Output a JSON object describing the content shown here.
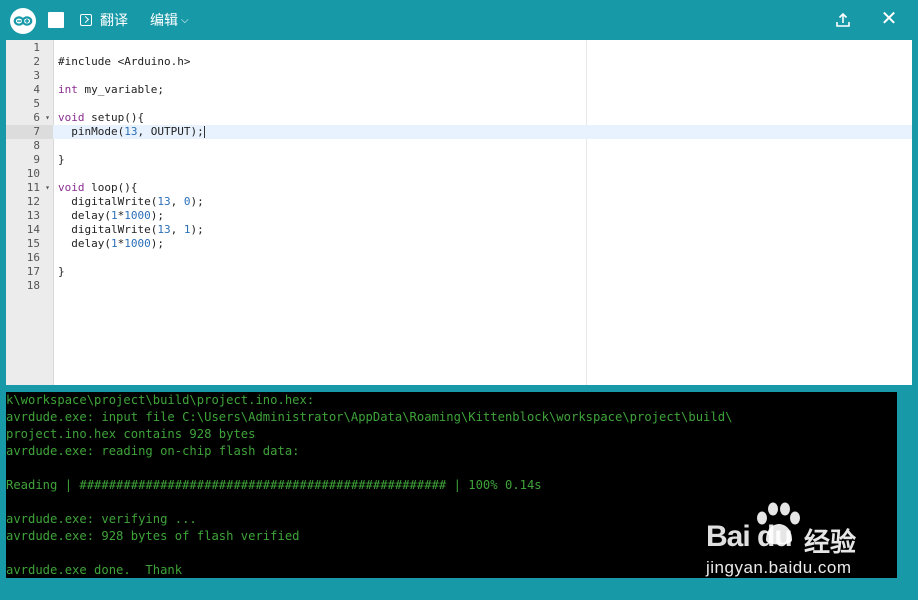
{
  "toolbar": {
    "compile_label": "翻译",
    "edit_label": "编辑"
  },
  "editor": {
    "line_numbers": [
      "1",
      "2",
      "3",
      "4",
      "5",
      "6",
      "7",
      "8",
      "9",
      "10",
      "11",
      "12",
      "13",
      "14",
      "15",
      "16",
      "17",
      "18"
    ],
    "active_line": 7,
    "fold_markers_on_lines": [
      6,
      11
    ]
  },
  "console": {
    "lines": [
      "k\\workspace\\project\\build\\project.ino.hex:",
      "avrdude.exe: input file C:\\Users\\Administrator\\AppData\\Roaming\\Kittenblock\\workspace\\project\\build\\",
      "project.ino.hex contains 928 bytes",
      "avrdude.exe: reading on-chip flash data:",
      "",
      "Reading | ################################################## | 100% 0.14s",
      "",
      "avrdude.exe: verifying ...",
      "avrdude.exe: 928 bytes of flash verified",
      "",
      "avrdude.exe done.  Thank"
    ]
  },
  "watermark": {
    "logo": "Bai du",
    "brand": "经验",
    "url": "jingyan.baidu.com"
  },
  "colors": {
    "chrome": "#1799a8",
    "console_bg": "#000000",
    "console_text": "#3fa33a",
    "keyword": "#8a2e90",
    "number": "#2a6fb8"
  }
}
